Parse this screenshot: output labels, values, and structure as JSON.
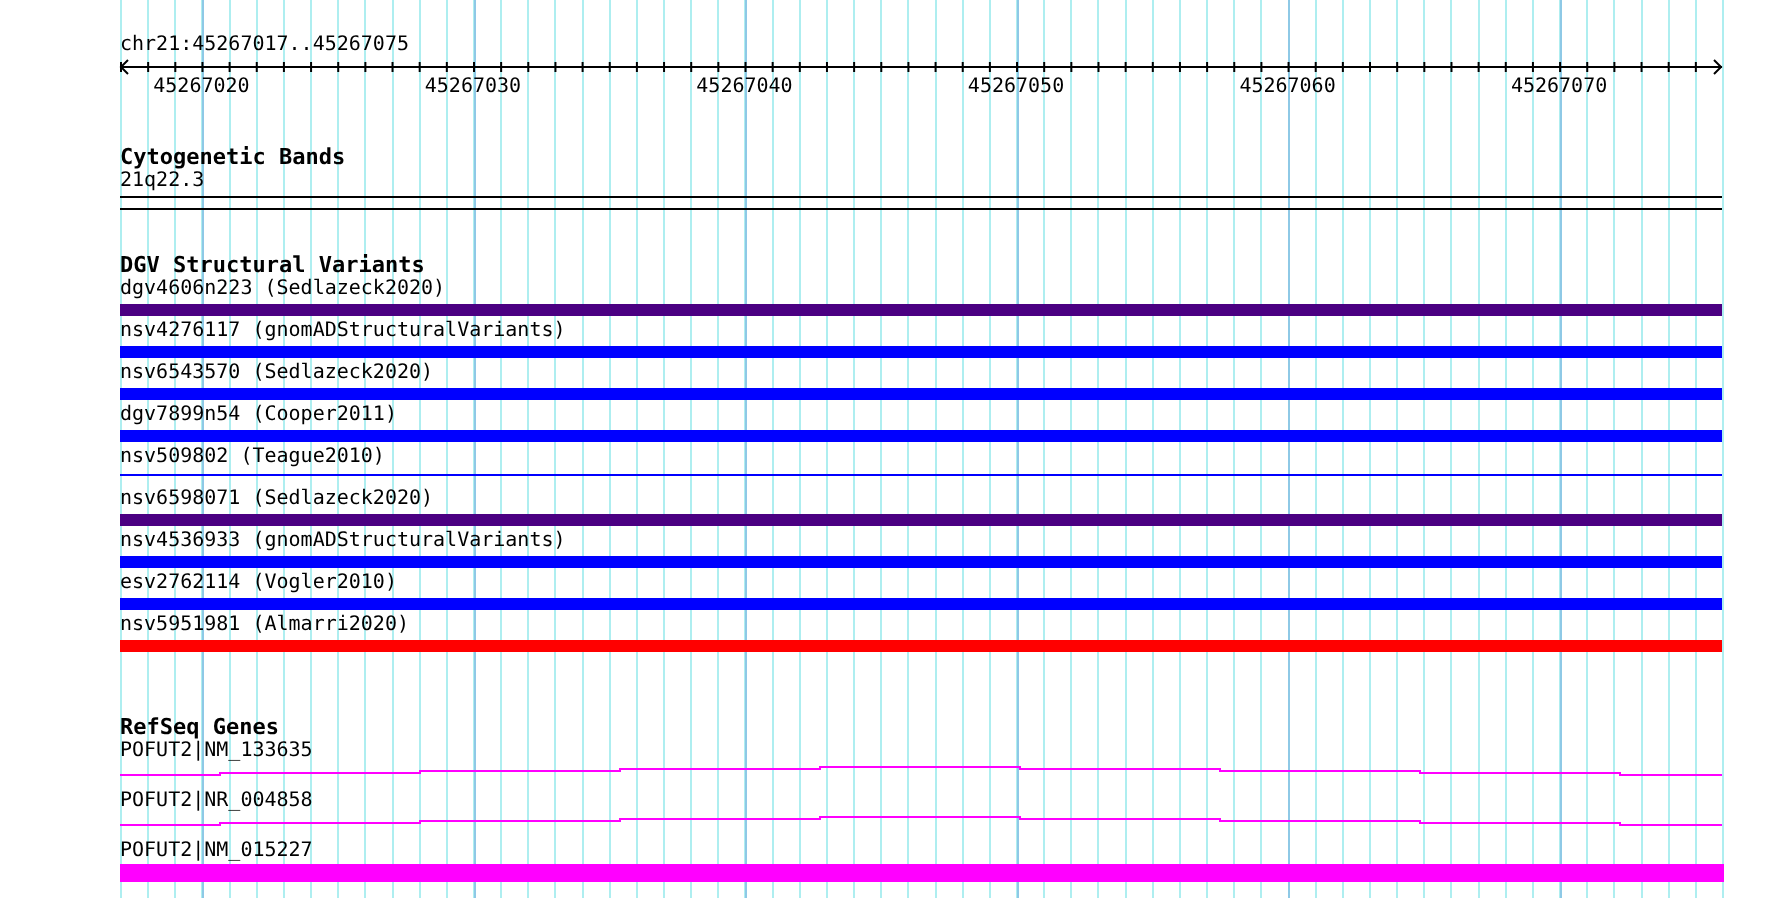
{
  "ruler": {
    "range": "chr21:45267017..45267075",
    "tick_labels": [
      "45267020",
      "45267030",
      "45267040",
      "45267050",
      "45267060",
      "45267070"
    ]
  },
  "cytogenetic_bands": {
    "title": "Cytogenetic Bands",
    "band": "21q22.3"
  },
  "dgv_structural_variants": {
    "title": "DGV Structural Variants",
    "items": [
      {
        "label": "dgv4606n223 (Sedlazeck2020)",
        "kind": "bar",
        "color": "#4b0082"
      },
      {
        "label": "nsv4276117 (gnomADStructuralVariants)",
        "kind": "bar",
        "color": "#0000ff"
      },
      {
        "label": "nsv6543570 (Sedlazeck2020)",
        "kind": "bar",
        "color": "#0000ff"
      },
      {
        "label": "dgv7899n54 (Cooper2011)",
        "kind": "bar",
        "color": "#0000ff"
      },
      {
        "label": "nsv509802 (Teague2010)",
        "kind": "line",
        "color": "#0000ff"
      },
      {
        "label": "nsv6598071 (Sedlazeck2020)",
        "kind": "bar",
        "color": "#4b0082"
      },
      {
        "label": "nsv4536933 (gnomADStructuralVariants)",
        "kind": "bar",
        "color": "#0000ff"
      },
      {
        "label": "esv2762114 (Vogler2010)",
        "kind": "bar",
        "color": "#0000ff"
      },
      {
        "label": "nsv5951981 (Almarri2020)",
        "kind": "bar",
        "color": "#ff0000"
      }
    ]
  },
  "refseq_genes": {
    "title": "RefSeq Genes",
    "items": [
      {
        "label": "POFUT2|NM_133635",
        "kind": "intron"
      },
      {
        "label": "POFUT2|NR_004858",
        "kind": "intron"
      },
      {
        "label": "POFUT2|NM_015227",
        "kind": "exon"
      }
    ]
  }
}
